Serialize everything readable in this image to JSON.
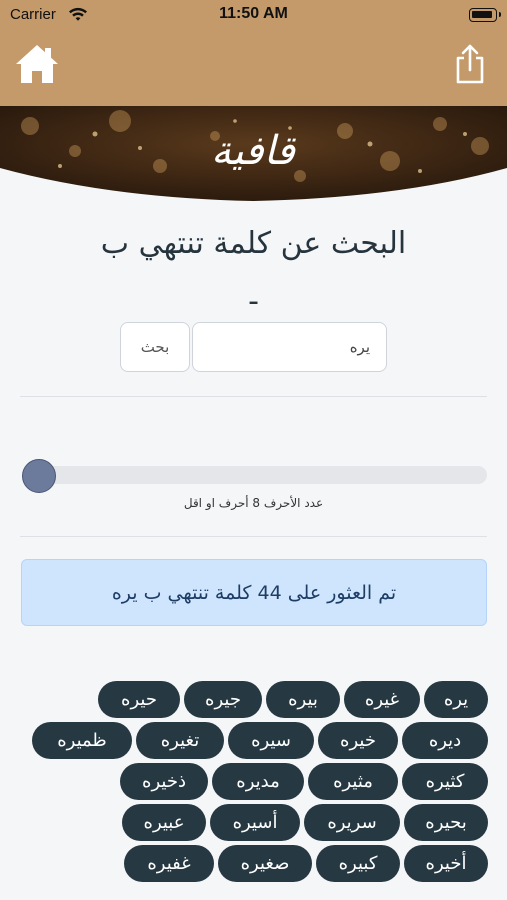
{
  "status": {
    "carrier": "Carrier",
    "time": "11:50 AM"
  },
  "nav": {
    "home_icon": "home-icon",
    "share_icon": "share-icon"
  },
  "banner": {
    "logo_text": "قافية"
  },
  "title": {
    "line1": "البحث عن كلمة تنتهي ب",
    "line2": "-"
  },
  "search": {
    "value": "يره",
    "button_label": "بحث"
  },
  "slider": {
    "caption": "عدد الأحرف 8 أحرف او اقل",
    "level": 0
  },
  "result": {
    "message": "تم العثور على 44 كلمة تنتهي ب يره"
  },
  "words": [
    [
      "يره",
      "غيره",
      "بيره",
      "جيره",
      "حيره"
    ],
    [
      "ديره",
      "خيره",
      "سيره",
      "تغيره",
      "ظميره"
    ],
    [
      "كثيره",
      "مثيره",
      "مديره",
      "ذخيره"
    ],
    [
      "بحيره",
      "سريره",
      "أسيره",
      "عبيره"
    ],
    [
      "أخيره",
      "كبيره",
      "صغيره",
      "غفيره"
    ]
  ],
  "colors": {
    "bar": "#c49a6b",
    "chip": "#263842",
    "alert_bg": "#cfe5fd"
  }
}
